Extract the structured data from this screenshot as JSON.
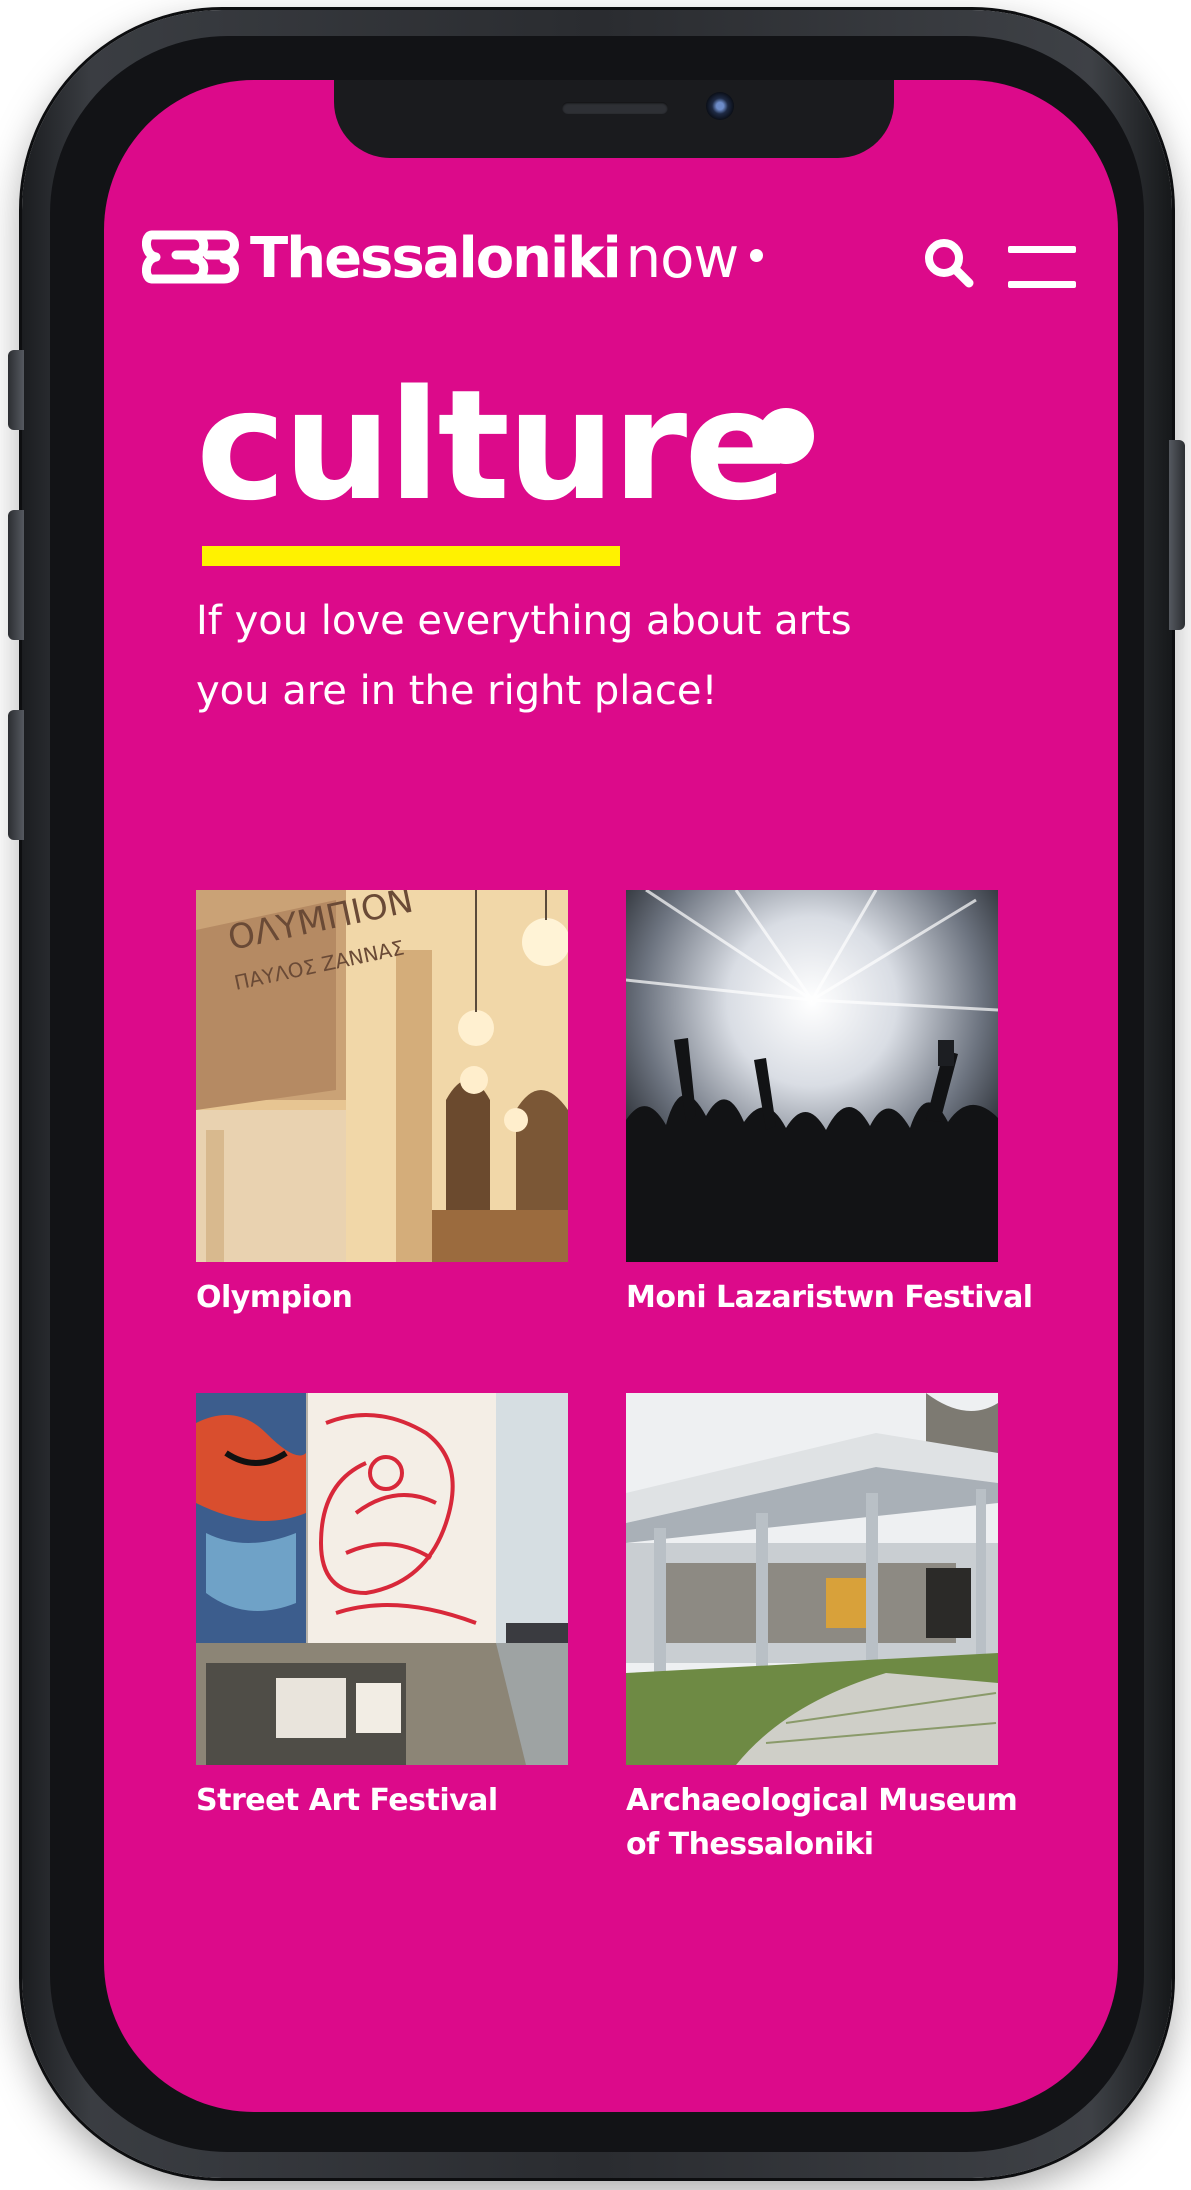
{
  "header": {
    "brand_name": "Thessaloniki",
    "brand_suffix": "now",
    "search_icon": "search-icon",
    "menu_icon": "hamburger-menu-icon"
  },
  "hero": {
    "title": "culture",
    "subtitle_lines": [
      "If you love everything about arts",
      "you are in the right place!"
    ]
  },
  "cards": [
    {
      "lines": [
        "Olympion"
      ]
    },
    {
      "lines": [
        "Moni Lazaristwn Festival"
      ]
    },
    {
      "lines": [
        "Street Art Festival"
      ]
    },
    {
      "lines": [
        "Archaeological Museum",
        "of Thessaloniki"
      ]
    }
  ],
  "colors": {
    "screen_background": "#dc0a8a",
    "accent_underline": "#fff200",
    "text": "#ffffff"
  }
}
